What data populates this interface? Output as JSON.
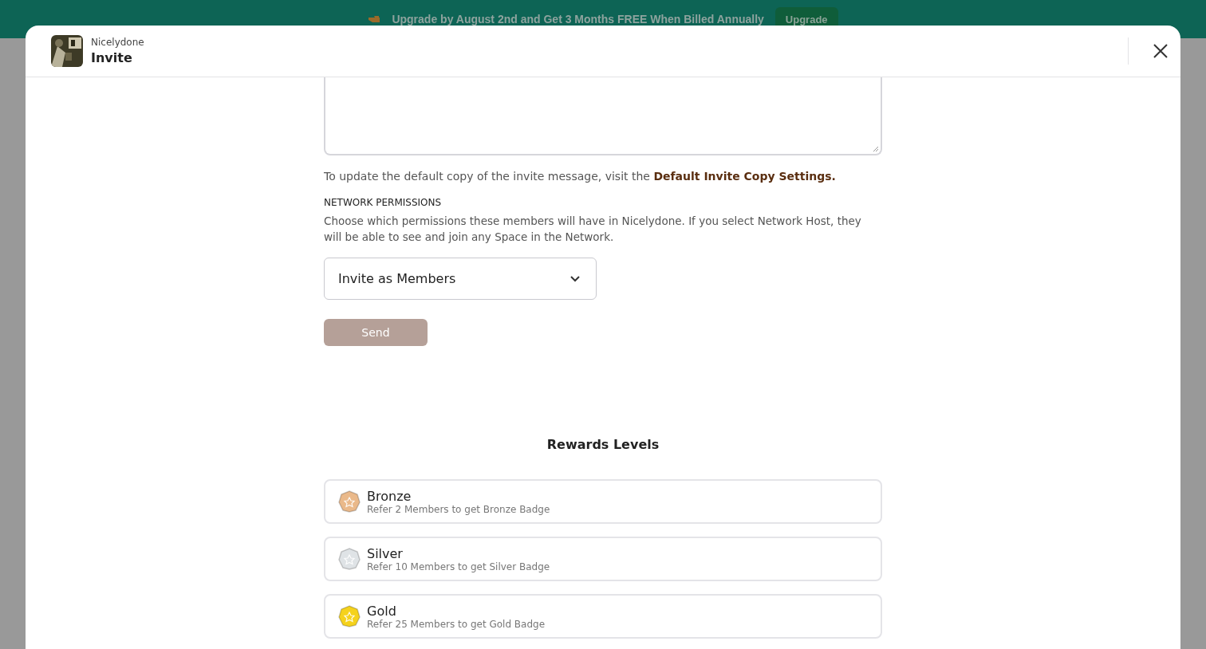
{
  "banner": {
    "text": "Upgrade by August 2nd and Get 3 Months FREE When Billed Annually",
    "button": "Upgrade"
  },
  "modal": {
    "network": "Nicelydone",
    "title": "Invite",
    "help": {
      "text": "To update the default copy of the invite message, visit the",
      "link": "Default Invite Copy Settings."
    },
    "permissions": {
      "heading": "NETWORK PERMISSIONS",
      "description": "Choose which permissions these members will have in Nicelydone. If you select Network Host, they will be able to see and join any Space in the Network.",
      "select": "Invite as Members"
    },
    "send": {
      "label": "Send",
      "disabled": true
    },
    "rewards": {
      "title": "Rewards Levels",
      "levels": [
        {
          "name": "Bronze",
          "description": "Refer 2 Members to get Bronze Badge",
          "color": "#eab98a"
        },
        {
          "name": "Silver",
          "description": "Refer 10 Members to get Silver Badge",
          "color": "#dfe3e6"
        },
        {
          "name": "Gold",
          "description": "Refer 25 Members to get Gold Badge",
          "color": "#f5d21c"
        }
      ]
    }
  }
}
